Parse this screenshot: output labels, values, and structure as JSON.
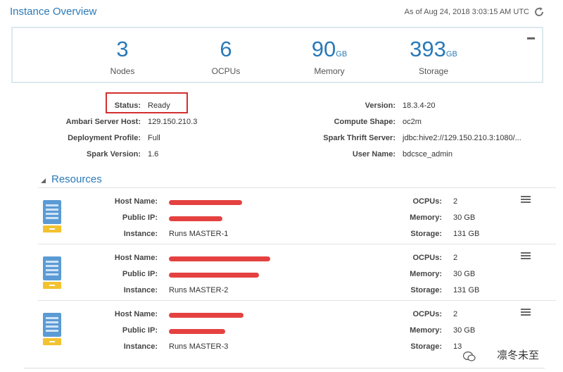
{
  "header": {
    "title": "Instance Overview",
    "as_of": "As of Aug 24, 2018 3:03:15 AM UTC"
  },
  "summary": {
    "nodes": {
      "value": "3",
      "unit": "",
      "label": "Nodes"
    },
    "ocpus": {
      "value": "6",
      "unit": "",
      "label": "OCPUs"
    },
    "memory": {
      "value": "90",
      "unit": "GB",
      "label": "Memory"
    },
    "storage": {
      "value": "393",
      "unit": "GB",
      "label": "Storage"
    }
  },
  "info": {
    "status_label": "Status:",
    "status": "Ready",
    "ambari_label": "Ambari Server Host:",
    "ambari": "129.150.210.3",
    "profile_label": "Deployment Profile:",
    "profile": "Full",
    "spark_label": "Spark Version:",
    "spark": "1.6",
    "version_label": "Version:",
    "version": "18.3.4-20",
    "shape_label": "Compute Shape:",
    "shape": "oc2m",
    "thrift_label": "Spark Thrift Server:",
    "thrift": "jdbc:hive2://129.150.210.3:1080/...",
    "user_label": "User Name:",
    "user": "bdcsce_admin"
  },
  "resources": {
    "title": "Resources",
    "labels": {
      "host_name": "Host Name:",
      "public_ip": "Public IP:",
      "instance": "Instance:",
      "ocpus": "OCPUs:",
      "memory": "Memory:",
      "storage": "Storage:"
    },
    "hosts": [
      {
        "instance": "Runs MASTER-1",
        "ocpus": "2",
        "memory": "30 GB",
        "storage": "131 GB"
      },
      {
        "instance": "Runs MASTER-2",
        "ocpus": "2",
        "memory": "30 GB",
        "storage": "131 GB"
      },
      {
        "instance": "Runs MASTER-3",
        "ocpus": "2",
        "memory": "30 GB",
        "storage": "13"
      }
    ]
  },
  "watermark": "凛冬未至",
  "colors": {
    "accent": "#2a7ab8",
    "status_highlight": "#d32f2f",
    "redaction": "#e02020",
    "server_icon": "#5b9bd5",
    "server_base": "#f2c230"
  }
}
